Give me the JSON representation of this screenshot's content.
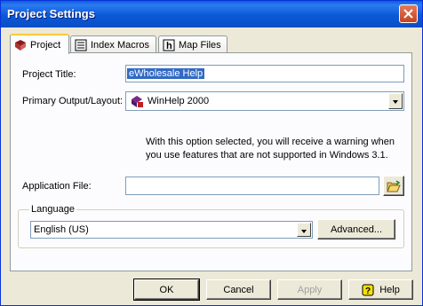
{
  "window": {
    "title": "Project Settings",
    "close_icon": "close-icon"
  },
  "tabs": [
    {
      "label": "Project",
      "icon": "book-icon",
      "active": true
    },
    {
      "label": "Index Macros",
      "icon": "index-icon",
      "active": false
    },
    {
      "label": "Map Files",
      "icon": "help-h-icon",
      "active": false
    }
  ],
  "project": {
    "title_label": "Project Title:",
    "title_value": "eWholesale Help",
    "output_label": "Primary Output/Layout:",
    "output_value": "WinHelp 2000",
    "note_line1": "With this option selected, you will receive a warning when",
    "note_line2": "you use features that are not supported in Windows 3.1.",
    "app_file_label": "Application File:",
    "app_file_value": "",
    "language_group": "Language",
    "language_value": "English (US)",
    "advanced_label": "Advanced..."
  },
  "buttons": {
    "ok": "OK",
    "cancel": "Cancel",
    "apply": "Apply",
    "help": "Help"
  }
}
